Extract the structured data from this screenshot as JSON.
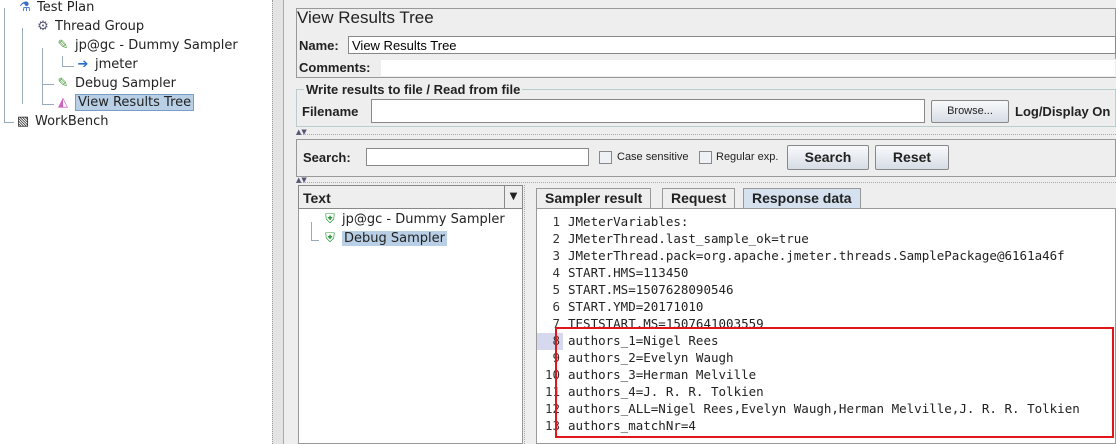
{
  "tree": {
    "items": [
      {
        "label": "Test Plan",
        "icon": "flask-icon"
      },
      {
        "label": "Thread Group",
        "icon": "gear-icon"
      },
      {
        "label": "jp@gc - Dummy Sampler",
        "icon": "pipette-icon"
      },
      {
        "label": "jmeter",
        "icon": "arrow-doc-icon"
      },
      {
        "label": "Debug Sampler",
        "icon": "pipette-icon"
      },
      {
        "label": "View Results Tree",
        "icon": "chart-icon",
        "selected": true
      },
      {
        "label": "WorkBench",
        "icon": "notebook-icon"
      }
    ]
  },
  "panel": {
    "title": "View Results Tree",
    "name_label": "Name:",
    "name_value": "View Results Tree",
    "comments_label": "Comments:",
    "file_group": "Write results to file / Read from file",
    "filename_label": "Filename",
    "filename_value": "",
    "browse": "Browse...",
    "log_display": "Log/Display On",
    "search_label": "Search:",
    "search_value": "",
    "case_sensitive": "Case sensitive",
    "regex": "Regular exp.",
    "search_btn": "Search",
    "reset_btn": "Reset",
    "renderer": "Text"
  },
  "results": [
    {
      "label": "jp@gc - Dummy Sampler",
      "status": "success"
    },
    {
      "label": "Debug Sampler",
      "status": "success",
      "selected": true
    }
  ],
  "tabs": [
    "Sampler result",
    "Request",
    "Response data"
  ],
  "active_tab": "Response data",
  "lines": [
    "JMeterVariables:",
    "JMeterThread.last_sample_ok=true",
    "JMeterThread.pack=org.apache.jmeter.threads.SamplePackage@6161a46f",
    "START.HMS=113450",
    "START.MS=1507628090546",
    "START.YMD=20171010",
    "TESTSTART.MS=1507641003559",
    "authors_1=Nigel Rees",
    "authors_2=Evelyn Waugh",
    "authors_3=Herman Melville",
    "authors_4=J. R. R. Tolkien",
    "authors_ALL=Nigel Rees,Evelyn Waugh,Herman Melville,J. R. R. Tolkien",
    "authors_matchNr=4"
  ],
  "line_numbers": [
    "1",
    "2",
    "3",
    "4",
    "5",
    "6",
    "7",
    "8",
    "9",
    "10",
    "11",
    "12",
    "13"
  ],
  "highlight_color": "#e0161b"
}
